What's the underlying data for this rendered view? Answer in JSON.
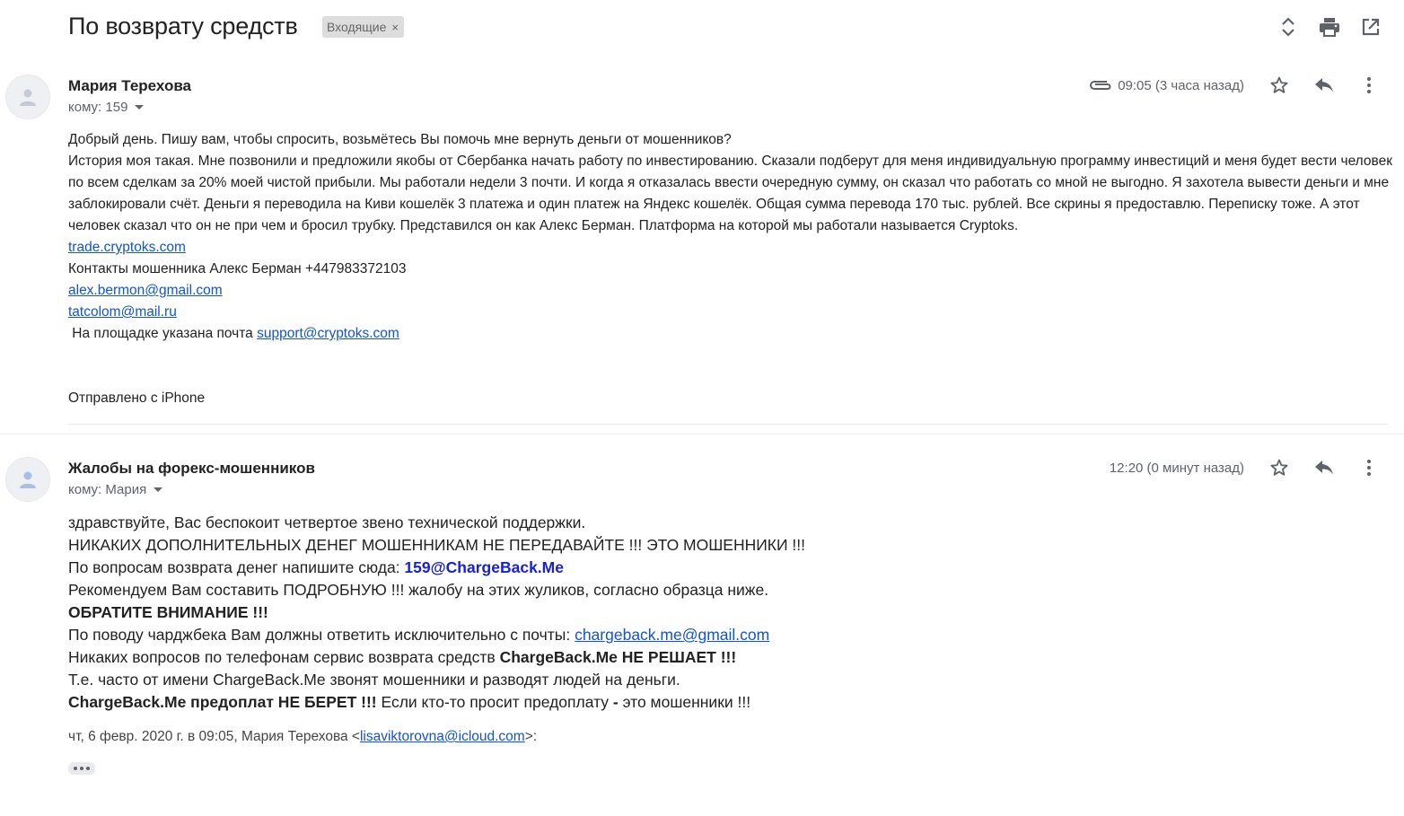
{
  "thread": {
    "subject": "По возврату средств",
    "label": "Входящие",
    "label_remove": "×"
  },
  "toolbar": {
    "icons": [
      "expand-collapse-icon",
      "print-icon",
      "open-new-window-icon"
    ]
  },
  "message1": {
    "sender": "Мария Терехова",
    "to": "кому: 159",
    "time": "09:05 (3 часа назад)",
    "has_attachment": true,
    "body": [
      "Добрый день. Пишу вам, чтобы спросить, возьмётесь Вы помочь мне вернуть деньги от мошенников?",
      "История моя такая. Мне позвонили и предложили якобы от Сбербанка начать работу по инвестированию. Сказали подберут для меня индивидуальную программу инвестиций и меня будет вести человек по всем сделкам за 20% моей чистой прибыли. Мы работали недели 3 почти. И когда я отказалась ввести очередную сумму, он сказал что работать со мной не выгодно. Я захотела вывести деньги и мне заблокировали счёт.  Деньги я переводила на Киви кошелёк 3 платежа и один платеж на Яндекс кошелёк.  Общая сумма перевода 170 тыс. рублей. Все скрины я предоставлю.  Переписку тоже. А этот человек сказал что он не при чем и бросил трубку. Представился он как Алекс Берман. Платформа на которой мы работали называется Cryptoks."
    ],
    "link_trade": "trade.cryptoks.com",
    "contacts_text": "Контакты мошенника Алекс Берман +447983372103",
    "email_1": "alex.bermon@gmail.com",
    "email_2": "tatcolom@mail.ru",
    "platform_text": " На площадке указана почта ",
    "support_email": "support@cryptoks.com",
    "signature": "Отправлено с iPhone"
  },
  "message2": {
    "sender": "Жалобы на форекс-мошенников",
    "to": "кому: Мария",
    "time": "12:20 (0 минут назад)",
    "line1": "здравствуйте, Вас беспокоит четвертое звено технической поддержки.",
    "line2": "НИКАКИХ ДОПОЛНИТЕЛЬНЫХ ДЕНЕГ МОШЕННИКАМ НЕ ПЕРЕДАВАЙТЕ !!! ЭТО МОШЕННИКИ !!!",
    "line3_prefix": "По вопросам возврата денег напишите сюда: ",
    "line3_email": "159@ChargeBack.Me",
    "line4": "Рекомендуем Вам составить ПОДРОБНУЮ !!! жалобу на этих жуликов, согласно образца ниже.",
    "line5": "ОБРАТИТЕ ВНИМАНИЕ !!!",
    "line6_prefix": "По поводу чарджбека Вам должны ответить исключительно с почты: ",
    "line6_email": "chargeback.me@gmail.com",
    "line7_prefix": "Никаких вопросов по телефонам сервис возврата средств ",
    "line7_bold": "ChargeBack.Me НЕ РЕШАЕТ !!!",
    "line8": "Т.е. часто от имени ChargeBack.Me звонят мошенники и разводят людей на деньги.",
    "line9_bold": "ChargeBack.Me предоплат НЕ БЕРЕТ !!!",
    "line9_rest": " Если кто-то просит предоплату ",
    "line9_dash": "-",
    "line9_end": " это мошенники !!!",
    "quote_prefix": "чт, 6 февр. 2020 г. в 09:05, Мария Терехова <",
    "quote_email": "lisaviktorovna@icloud.com",
    "quote_suffix": ">:"
  }
}
